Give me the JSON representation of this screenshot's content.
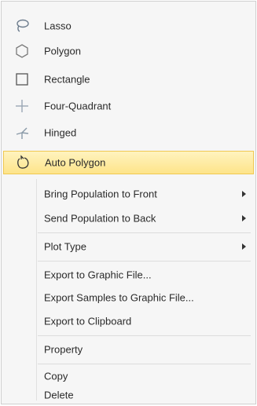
{
  "menu": {
    "lasso": "Lasso",
    "polygon": "Polygon",
    "rectangle": "Rectangle",
    "four_quadrant": "Four-Quadrant",
    "hinged": "Hinged",
    "auto_polygon": "Auto Polygon",
    "bring_front": "Bring Population to Front",
    "send_back": "Send Population to Back",
    "plot_type": "Plot Type",
    "export_graphic": "Export to Graphic File...",
    "export_samples": "Export Samples to Graphic File...",
    "export_clipboard": "Export to Clipboard",
    "property": "Property",
    "copy": "Copy",
    "delete": "Delete"
  },
  "icons": {
    "lasso": "lasso-icon",
    "polygon": "polygon-icon",
    "rectangle": "rectangle-icon",
    "four_quadrant": "four-quadrant-icon",
    "hinged": "hinged-icon",
    "auto_polygon": "auto-polygon-icon"
  },
  "colors": {
    "highlight": "#fde48a",
    "highlight_border": "#f0c850",
    "background": "#f6f6f6"
  }
}
